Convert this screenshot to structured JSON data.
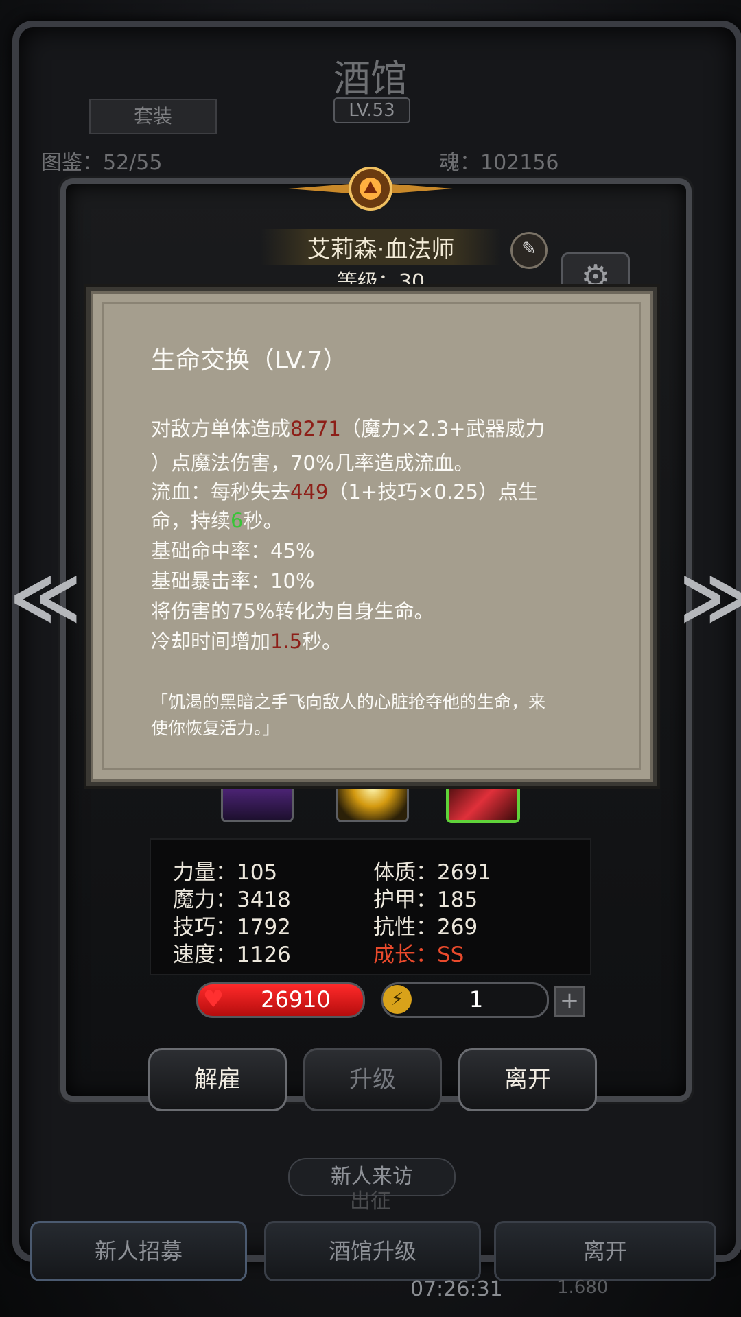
{
  "tavern": {
    "title": "酒馆",
    "level": "LV.53",
    "set_tab": "套装",
    "left_stat": "图鉴：52/55",
    "right_stat": "魂：102156",
    "new_visit": "新人来访",
    "expedition": "出征",
    "timer": "07:26:31",
    "timer2": "1.680"
  },
  "bottom_buttons": {
    "recruit": "新人招募",
    "upgrade": "酒馆升级",
    "leave": "离开"
  },
  "hero": {
    "name": "艾莉森·血法师",
    "level_label": "等级：30",
    "edit_icon": "pencil-icon",
    "settings_icon": "gear-icon"
  },
  "skill_tooltip": {
    "title": "生命交换（LV.7）",
    "l1_a": "对敌方单体造成",
    "l1_num": "8271",
    "l1_b": "（魔力×2.3+武器威力",
    "l2": "）点魔法伤害，70%几率造成流血。",
    "l3_a": "流血：每秒失去",
    "l3_num": "449",
    "l3_b": "（1+技巧×0.25）点生",
    "l4_a": "命，持续",
    "l4_num": "6",
    "l4_b": "秒。",
    "l5": "基础命中率：45%",
    "l6": "基础暴击率：10%",
    "l7": "将伤害的75%转化为自身生命。",
    "l8_a": "冷却时间增加",
    "l8_num": "1.5",
    "l8_b": "秒。",
    "quote1": "「饥渴的黑暗之手飞向敌人的心脏抢夺他的生命，来",
    "quote2": "使你恢复活力。」",
    "colors": {
      "damage": "#8d1f18",
      "duration": "#39c437"
    }
  },
  "stats": {
    "strength": "力量：105",
    "magic": "魔力：3418",
    "skill": "技巧：1792",
    "speed": "速度：1126",
    "constitution": "体质：2691",
    "armor": "护甲：185",
    "resistance": "抗性：269",
    "growth": "成长：SS"
  },
  "resources": {
    "hp": "26910",
    "energy": "1",
    "hp_icon": "heart-icon",
    "energy_icon": "lightning-icon",
    "plus": "+"
  },
  "actions": {
    "dismiss": "解雇",
    "level_up": "升级",
    "leave": "离开"
  },
  "nav": {
    "prev": "≪",
    "next": "≫"
  }
}
